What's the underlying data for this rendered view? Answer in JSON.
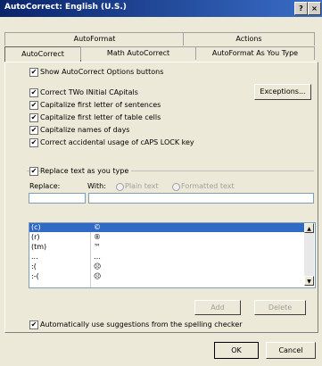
{
  "window": {
    "title": "AutoCorrect: English (U.S.)",
    "help_glyph": "?",
    "close_glyph": "×"
  },
  "tabs": {
    "top": [
      "AutoFormat",
      "Actions"
    ],
    "bottom": [
      "AutoCorrect",
      "Math AutoCorrect",
      "AutoFormat As You Type"
    ],
    "selected": "AutoCorrect"
  },
  "options": {
    "show_buttons": "Show AutoCorrect Options buttons",
    "two_initial": "Correct TWo INitial CApitals",
    "first_sentence": "Capitalize first letter of sentences",
    "first_table": "Capitalize first letter of table cells",
    "names_days": "Capitalize names of days",
    "caps_lock": "Correct accidental usage of cAPS LOCK key",
    "checkmark": "✔"
  },
  "exceptions_button": "Exceptions...",
  "replace": {
    "checkbox_label": "Replace text as you type",
    "replace_label": "Replace:",
    "with_label": "With:",
    "plain_text": "Plain text",
    "formatted_text": "Formatted text",
    "replace_value": "",
    "with_value": ""
  },
  "entries": [
    {
      "from": "(c)",
      "to": "©"
    },
    {
      "from": "(r)",
      "to": "®"
    },
    {
      "from": "(tm)",
      "to": "™"
    },
    {
      "from": "...",
      "to": "…"
    },
    {
      "from": ":(",
      "to": "☹"
    },
    {
      "from": ":-(",
      "to": "☹"
    }
  ],
  "selected_entry": 0,
  "add_button": "Add",
  "delete_button": "Delete",
  "suggestions": "Automatically use suggestions from the spelling checker",
  "ok_button": "OK",
  "cancel_button": "Cancel",
  "scroll_up": "▲",
  "scroll_down": "▼"
}
